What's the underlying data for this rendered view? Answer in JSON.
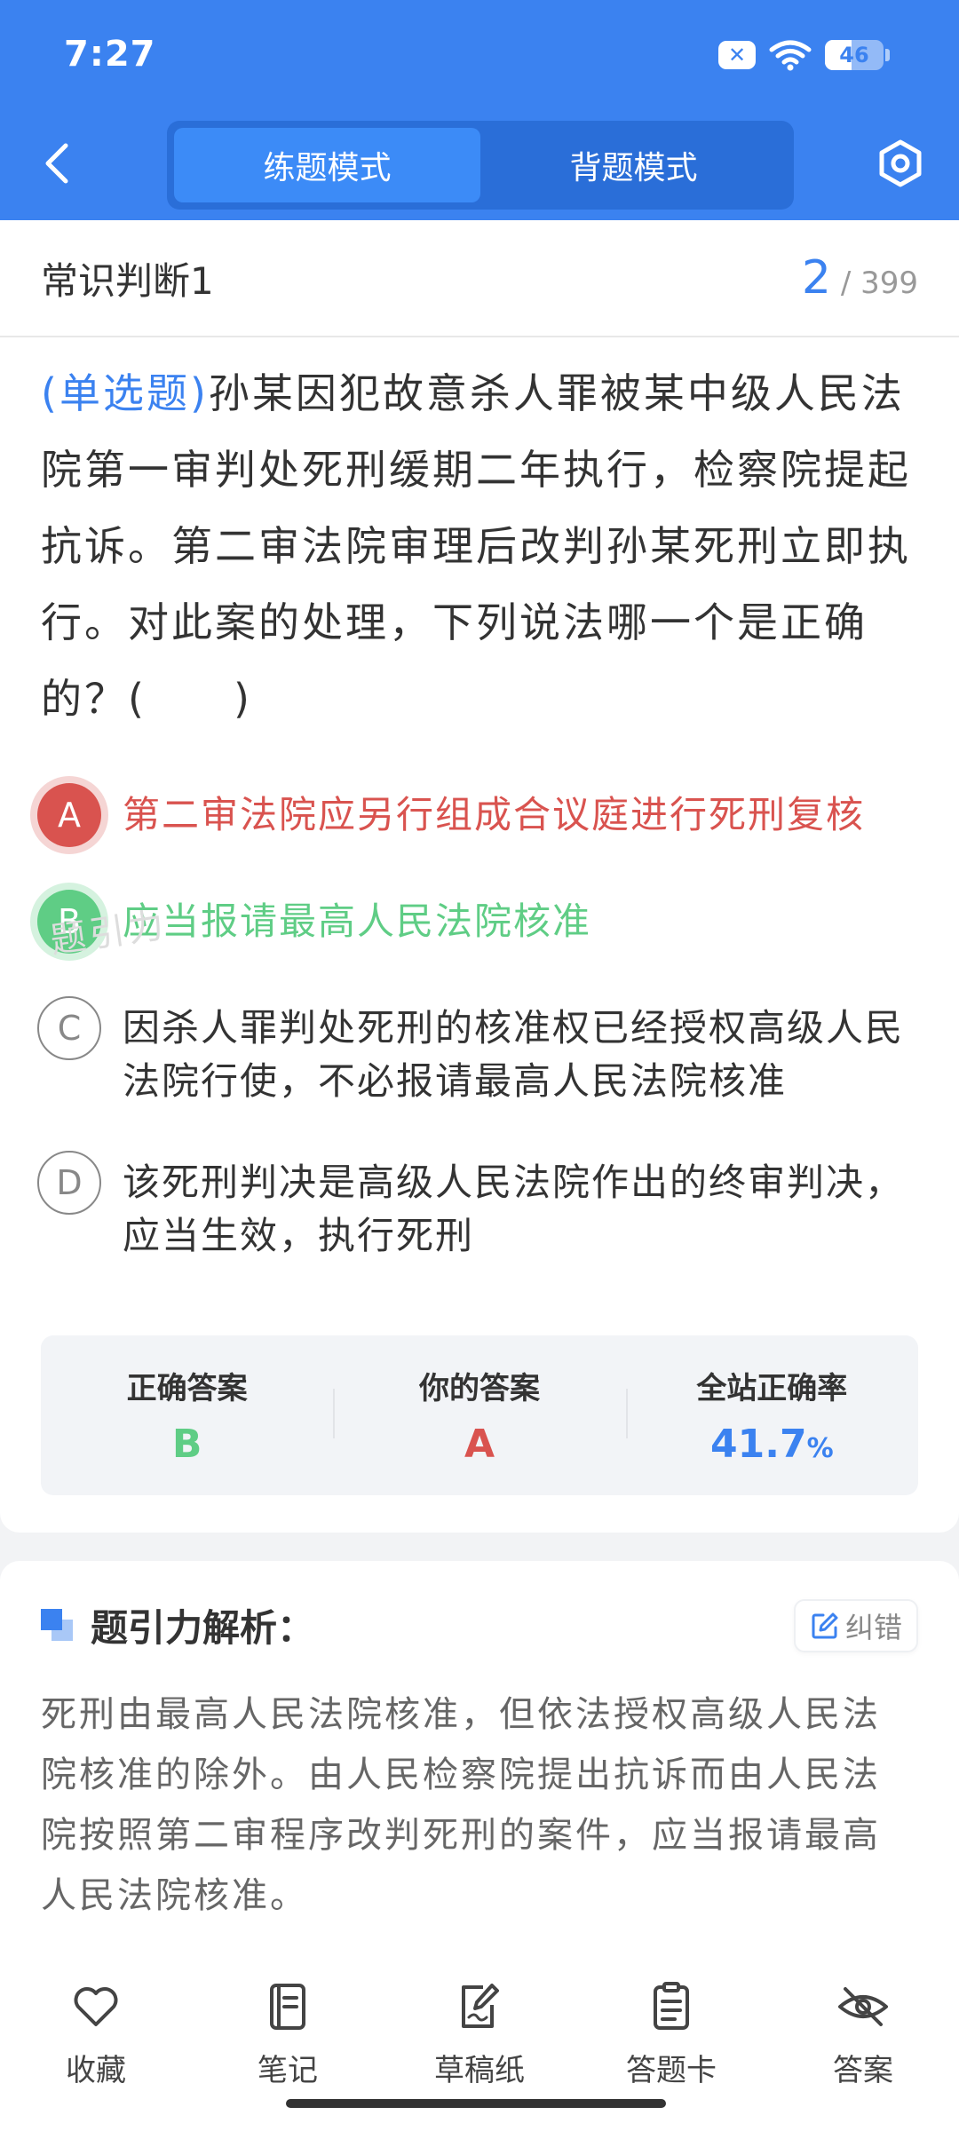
{
  "status_bar": {
    "time": "7:27",
    "battery": "46",
    "battery_level": 0.46
  },
  "header": {
    "tabs": [
      {
        "label": "练题模式",
        "active": true
      },
      {
        "label": "背题模式",
        "active": false
      }
    ],
    "back_icon": "chevron-left-icon",
    "settings_icon": "hexagon-settings-icon"
  },
  "question_header": {
    "category": "常识判断1",
    "current": "2",
    "total": "/ 399"
  },
  "question": {
    "type": "(单选题)",
    "text": "孙某因犯故意杀人罪被某中级人民法院第一审判处死刑缓期二年执行，检察院提起抗诉。第二审法院审理后改判孙某死刑立即执行。对此案的处理，下列说法哪一个是正确的？(　　)"
  },
  "options": [
    {
      "letter": "A",
      "text": "第二审法院应另行组成合议庭进行死刑复核",
      "state": "wrong"
    },
    {
      "letter": "B",
      "text": "应当报请最高人民法院核准",
      "state": "correct"
    },
    {
      "letter": "C",
      "text": "因杀人罪判处死刑的核准权已经授权高级人民法院行使，不必报请最高人民法院核准",
      "state": "none"
    },
    {
      "letter": "D",
      "text": "该死刑判决是高级人民法院作出的终审判决，应当生效，执行死刑",
      "state": "none"
    }
  ],
  "watermark": "题引力",
  "stats": {
    "correct_label": "正确答案",
    "correct_value": "B",
    "yours_label": "你的答案",
    "yours_value": "A",
    "rate_label": "全站正确率",
    "rate_value": "41.7",
    "rate_unit": "%"
  },
  "analysis": {
    "title": "题引力解析：",
    "correct_button": "纠错",
    "text": "死刑由最高人民法院核准，但依法授权高级人民法院核准的除外。由人民检察院提出抗诉而由人民法院按照第二审程序改判死刑的案件，应当报请最高人民法院核准。"
  },
  "bottom_nav": [
    {
      "label": "收藏",
      "icon": "heart-icon"
    },
    {
      "label": "笔记",
      "icon": "notebook-icon"
    },
    {
      "label": "草稿纸",
      "icon": "draft-paper-icon"
    },
    {
      "label": "答题卡",
      "icon": "answer-sheet-icon"
    },
    {
      "label": "答案",
      "icon": "eye-off-icon"
    }
  ],
  "colors": {
    "primary": "#3b82f0",
    "wrong": "#d9534f",
    "correct": "#5fcd85"
  }
}
